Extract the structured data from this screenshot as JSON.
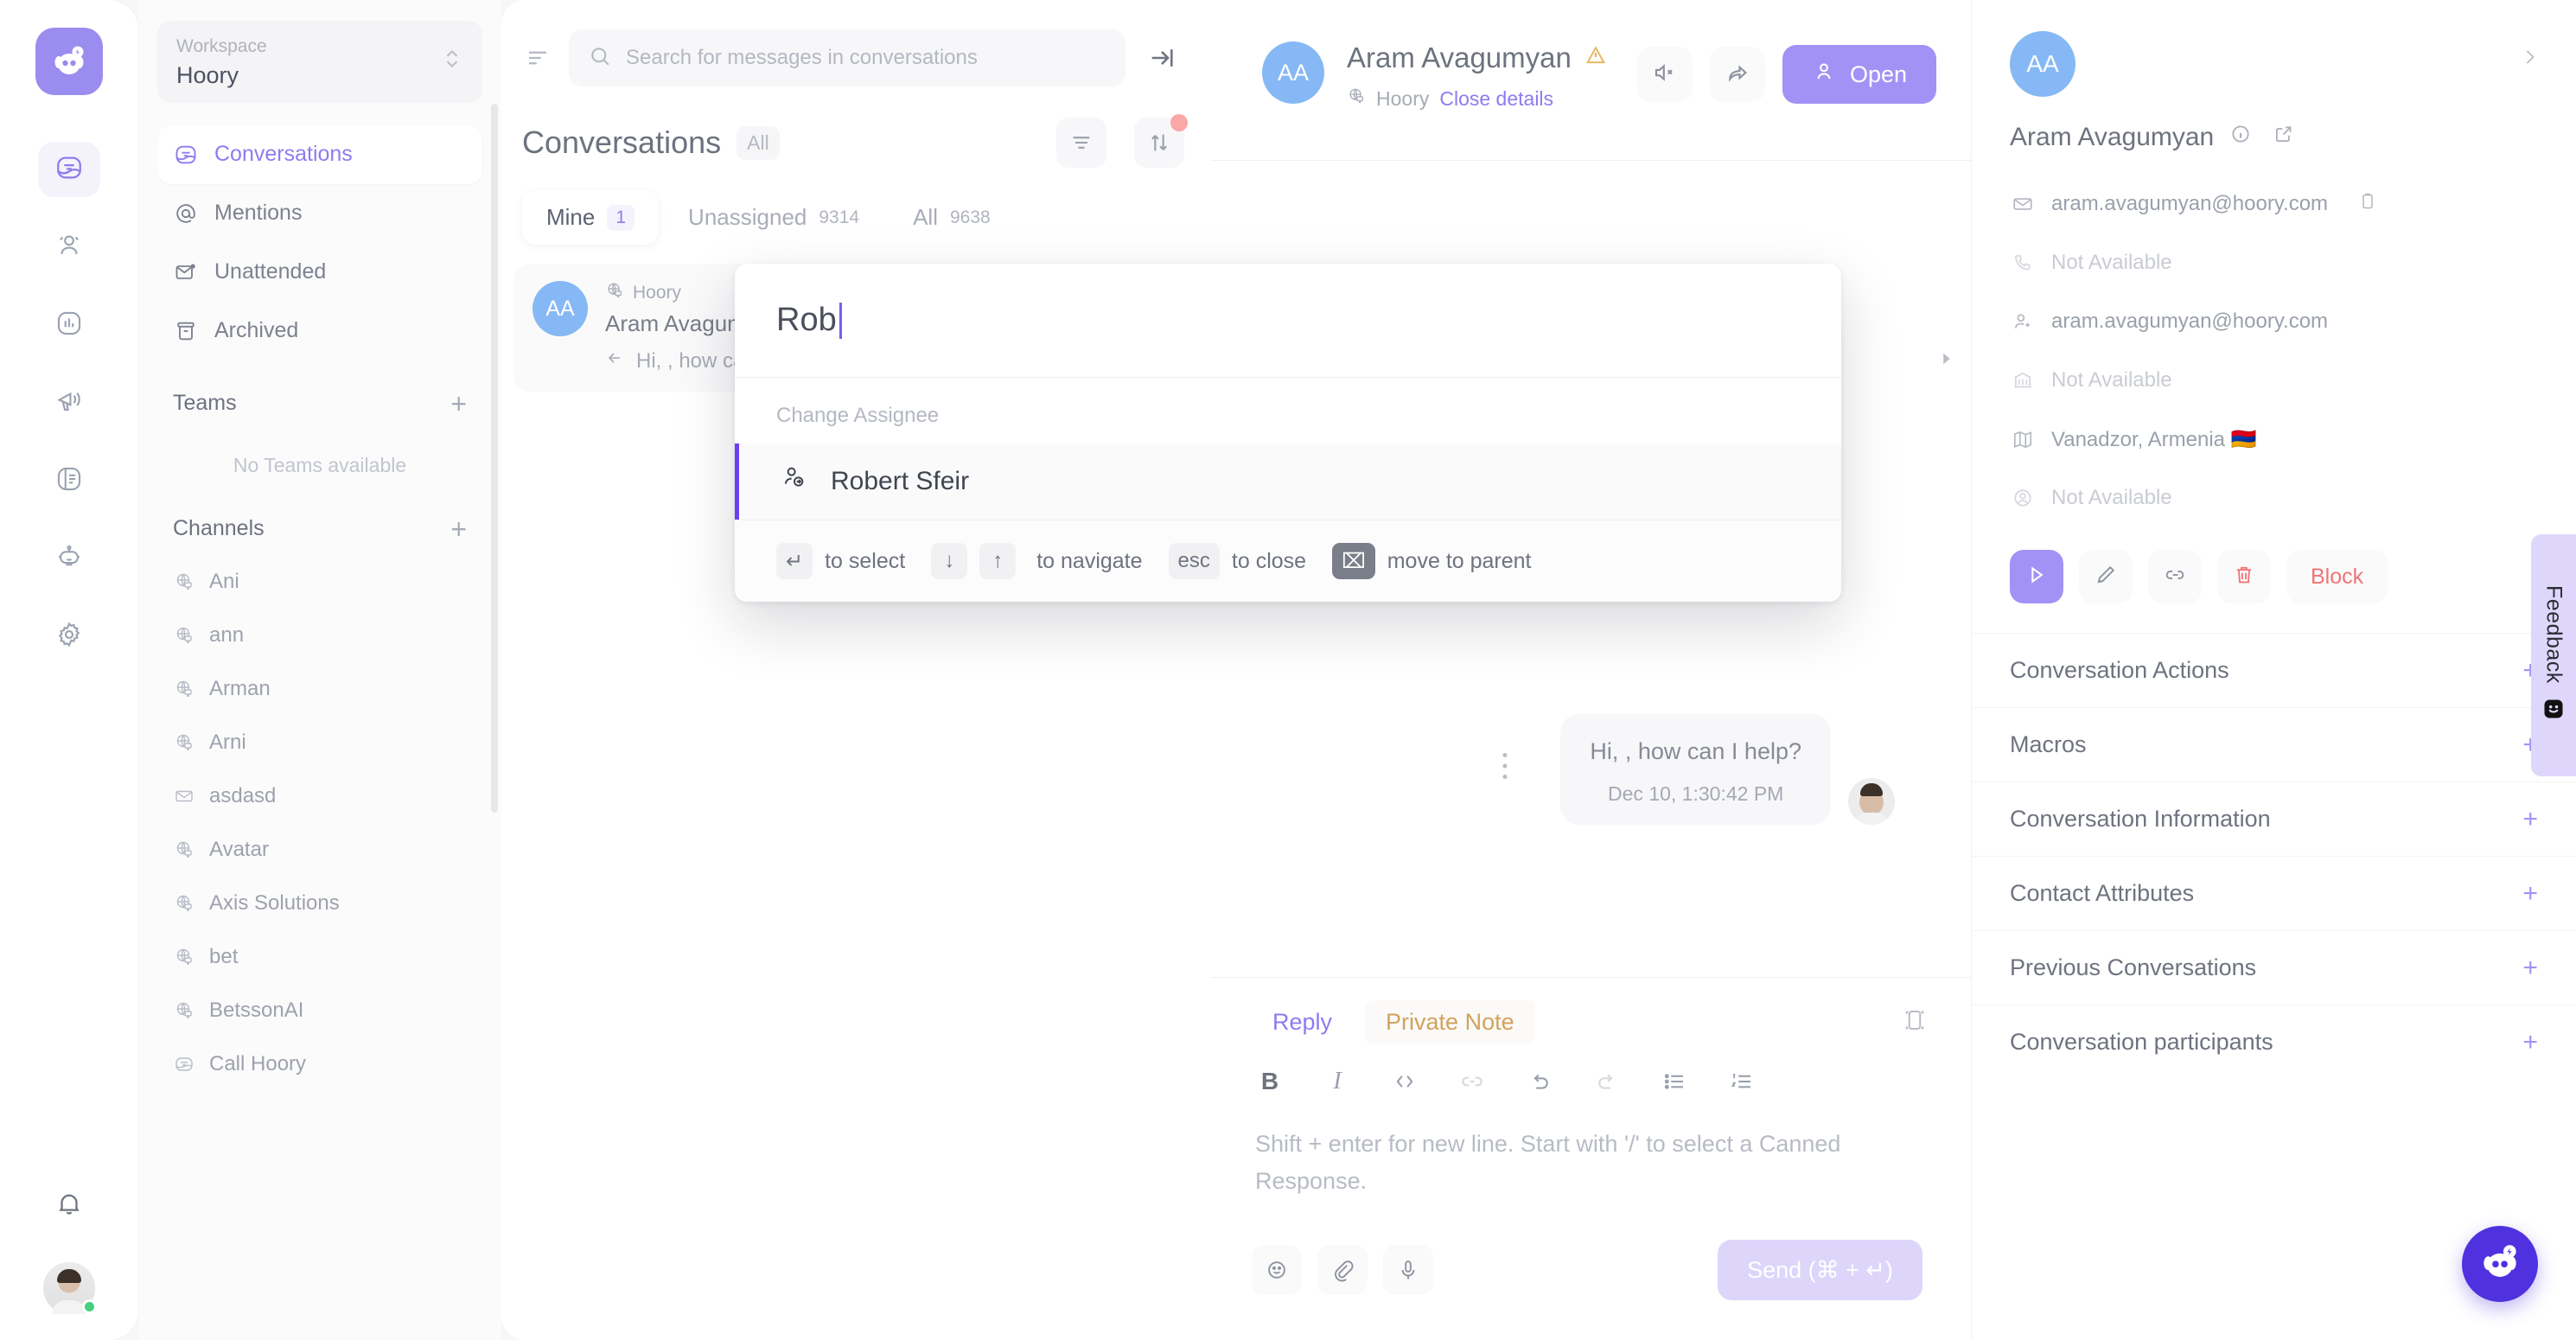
{
  "rail": {
    "logo_icon": "hoory-logo-icon",
    "items": [
      {
        "name": "conversations",
        "icon": "chat-bubble-icon",
        "active": true
      },
      {
        "name": "contacts",
        "icon": "people-icon",
        "active": false
      },
      {
        "name": "reports",
        "icon": "bar-chart-icon",
        "active": false
      },
      {
        "name": "campaigns",
        "icon": "megaphone-icon",
        "active": false
      },
      {
        "name": "knowledge-base",
        "icon": "book-icon",
        "active": false
      },
      {
        "name": "ai-assistant",
        "icon": "robot-icon",
        "active": false
      },
      {
        "name": "settings",
        "icon": "gear-icon",
        "active": false
      }
    ],
    "notifications_icon": "bell-icon",
    "avatar_status": "online"
  },
  "sidebar": {
    "workspace_label": "Workspace",
    "workspace_name": "Hoory",
    "nav": [
      {
        "label": "Conversations",
        "icon": "chat-bubble-icon",
        "active": true
      },
      {
        "label": "Mentions",
        "icon": "at-icon",
        "active": false
      },
      {
        "label": "Unattended",
        "icon": "envelope-dot-icon",
        "active": false
      },
      {
        "label": "Archived",
        "icon": "archive-icon",
        "active": false
      }
    ],
    "teams_heading": "Teams",
    "teams_empty": "No Teams available",
    "channels_heading": "Channels",
    "channels": [
      {
        "label": "Ani",
        "icon": "globe-icon"
      },
      {
        "label": "ann",
        "icon": "globe-icon"
      },
      {
        "label": "Arman",
        "icon": "globe-icon"
      },
      {
        "label": "Arni",
        "icon": "globe-icon"
      },
      {
        "label": "asdasd",
        "icon": "envelope-icon"
      },
      {
        "label": "Avatar",
        "icon": "globe-icon"
      },
      {
        "label": "Axis Solutions",
        "icon": "globe-icon"
      },
      {
        "label": "bet",
        "icon": "globe-icon"
      },
      {
        "label": "BetssonAI",
        "icon": "globe-icon"
      },
      {
        "label": "Call Hoory",
        "icon": "chat-bubble-icon"
      }
    ]
  },
  "conversation_list": {
    "search_placeholder": "Search for messages in conversations",
    "sort_icon": "sort-icon",
    "search_icon": "search-icon",
    "collapse_icon": "collapse-panel-icon",
    "title": "Conversations",
    "scope_label": "All",
    "filter_icon": "filter-icon",
    "sortorder_icon": "sort-arrows-icon",
    "tabs": [
      {
        "label": "Mine",
        "count": "1",
        "active": true
      },
      {
        "label": "Unassigned",
        "count": "9314",
        "active": false
      },
      {
        "label": "All",
        "count": "9638",
        "active": false
      }
    ],
    "items": [
      {
        "initials": "AA",
        "inbox": "Hoory",
        "inbox_icon": "globe-icon",
        "name": "Aram Avagumyan",
        "preview": "Hi, , how can I help?",
        "reply_icon": "reply-arrow-icon"
      }
    ]
  },
  "chat": {
    "header": {
      "initials": "AA",
      "name": "Aram Avagumyan",
      "warning_icon": "warning-triangle-icon",
      "inbox_icon": "globe-icon",
      "inbox": "Hoory",
      "details_link": "Close details",
      "mute_icon": "speaker-mute-icon",
      "forward_icon": "share-arrow-icon",
      "open_label": "Open",
      "open_icon": "person-icon"
    },
    "messages": [
      {
        "text": "Hi, , how can I help?",
        "timestamp": "Dec 10, 1:30:42 PM",
        "menu_icon": "more-vertical-icon"
      }
    ],
    "composer": {
      "tab_reply": "Reply",
      "tab_note": "Private Note",
      "expand_icon": "expand-editor-icon",
      "toolbar": [
        {
          "name": "bold",
          "glyph": "B"
        },
        {
          "name": "italic",
          "glyph": "I"
        },
        {
          "name": "code",
          "glyph": "</>"
        },
        {
          "name": "link",
          "glyph": "link-icon"
        },
        {
          "name": "undo",
          "glyph": "undo-icon"
        },
        {
          "name": "redo",
          "glyph": "redo-icon"
        },
        {
          "name": "bullet-list",
          "glyph": "bullet-list-icon"
        },
        {
          "name": "numbered-list",
          "glyph": "numbered-list-icon"
        }
      ],
      "placeholder": "Shift + enter for new line. Start with '/' to select a Canned Response.",
      "emoji_icon": "emoji-icon",
      "attach_icon": "paperclip-icon",
      "mic_icon": "microphone-icon",
      "send_label": "Send (⌘ + ↵)"
    }
  },
  "contact_panel": {
    "initials": "AA",
    "collapse_icon": "chevron-right-icon",
    "name": "Aram Avagumyan",
    "info_icon": "info-circle-icon",
    "external_icon": "external-link-icon",
    "fields": [
      {
        "icon": "envelope-icon",
        "value": "aram.avagumyan@hoory.com",
        "muted": false,
        "copy": true
      },
      {
        "icon": "phone-icon",
        "value": "Not Available",
        "muted": true,
        "copy": false
      },
      {
        "icon": "user-id-icon",
        "value": "aram.avagumyan@hoory.com",
        "muted": false,
        "copy": false
      },
      {
        "icon": "company-icon",
        "value": "Not Available",
        "muted": true,
        "copy": false
      },
      {
        "icon": "map-icon",
        "value": "Vanadzor, Armenia 🇦🇲",
        "muted": false,
        "copy": false
      },
      {
        "icon": "profile-circle-icon",
        "value": "Not Available",
        "muted": true,
        "copy": false
      }
    ],
    "actions": [
      {
        "name": "send-message",
        "icon": "send-icon",
        "primary": true
      },
      {
        "name": "edit-contact",
        "icon": "pencil-icon",
        "primary": false
      },
      {
        "name": "merge-contact",
        "icon": "link-icon",
        "primary": false
      },
      {
        "name": "delete-contact",
        "icon": "trash-icon",
        "primary": false
      }
    ],
    "block_label": "Block",
    "sections": [
      {
        "label": "Conversation Actions"
      },
      {
        "label": "Macros"
      },
      {
        "label": "Conversation Information"
      },
      {
        "label": "Contact Attributes"
      },
      {
        "label": "Previous Conversations"
      },
      {
        "label": "Conversation participants"
      }
    ]
  },
  "feedback": {
    "label": "Feedback",
    "icon": "smiley-square-icon"
  },
  "fab": {
    "icon": "hoory-logo-icon"
  },
  "palette": {
    "query": "Rob",
    "group_label": "Change Assignee",
    "results": [
      {
        "label": "Robert Sfeir",
        "icon": "assign-person-icon"
      }
    ],
    "hints": [
      {
        "keys": [
          "↵"
        ],
        "label": "to select"
      },
      {
        "keys": [
          "↓",
          "↑"
        ],
        "label": "to navigate"
      },
      {
        "keys": [
          "esc"
        ],
        "label": "to close"
      },
      {
        "keys": [
          "⌧"
        ],
        "label": "move to parent",
        "dark": true
      }
    ]
  },
  "colors": {
    "accent": "#8d7cf0",
    "accent_solid": "#a392f5",
    "brand_deep": "#4f31e0",
    "danger": "#f07575",
    "note": "#d3a25c"
  }
}
